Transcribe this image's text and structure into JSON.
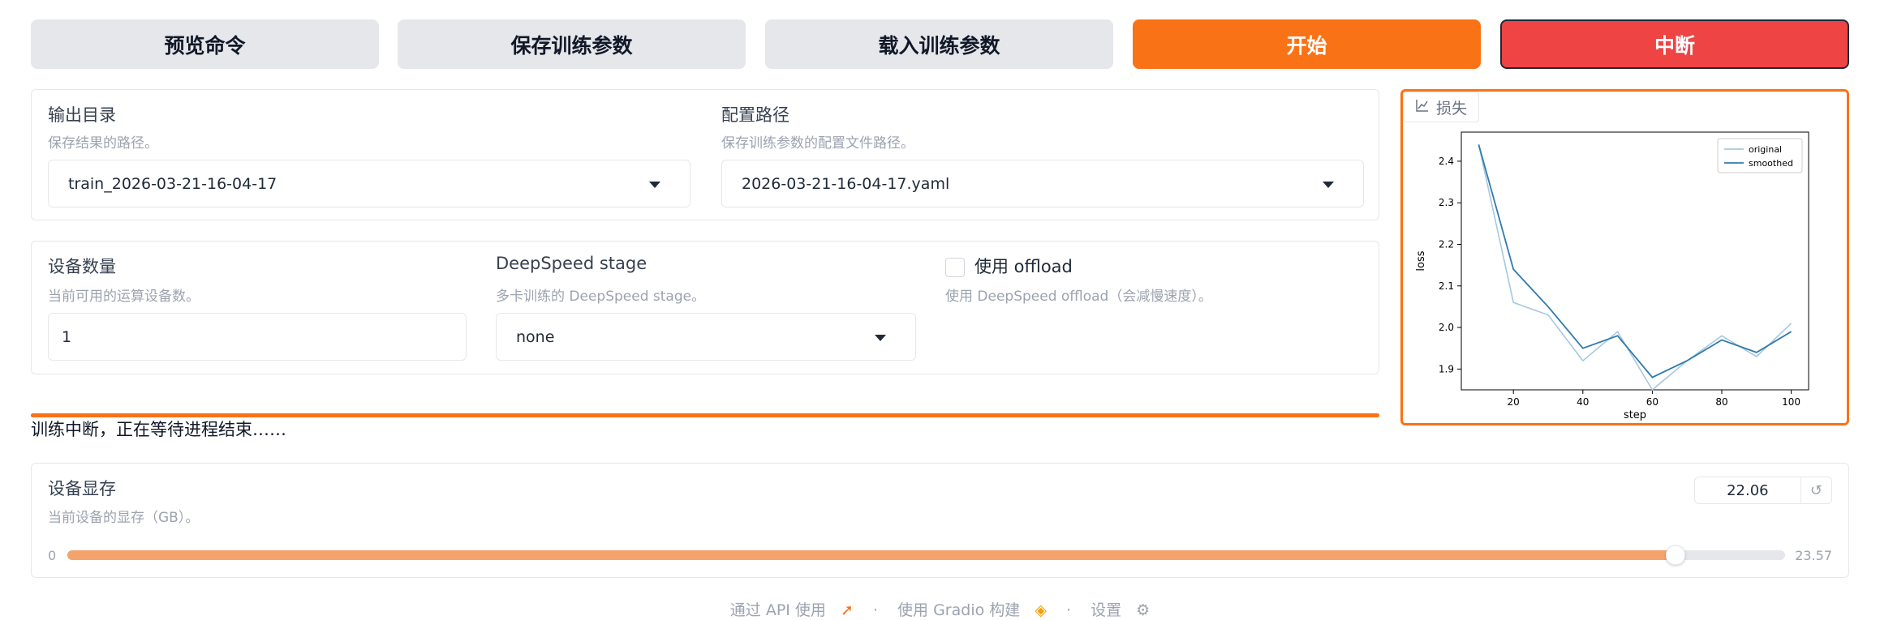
{
  "toolbar": {
    "preview_label": "预览命令",
    "save_label": "保存训练参数",
    "load_label": "载入训练参数",
    "start_label": "开始",
    "stop_label": "中断"
  },
  "output": {
    "output_dir_label": "输出目录",
    "output_dir_info": "保存结果的路径。",
    "output_dir_value": "train_2026-03-21-16-04-17",
    "config_path_label": "配置路径",
    "config_path_info": "保存训练参数的配置文件路径。",
    "config_path_value": "2026-03-21-16-04-17.yaml"
  },
  "device": {
    "count_label": "设备数量",
    "count_info": "当前可用的运算设备数。",
    "count_value": "1",
    "ds_stage_label": "DeepSpeed stage",
    "ds_stage_info": "多卡训练的 DeepSpeed stage。",
    "ds_stage_value": "none",
    "offload_label": "使用 offload",
    "offload_info": "使用 DeepSpeed offload（会减慢速度）。",
    "offload_checked": false
  },
  "status": {
    "message": "训练中断，正在等待进程结束……",
    "progress": 1.0
  },
  "memory": {
    "label": "设备显存",
    "info": "当前设备的显存（GB）。",
    "value": "22.06",
    "min": "0",
    "max": "23.57",
    "reset_icon": "↺"
  },
  "plot": {
    "tag_label": "损失",
    "tag_icon": "chart-icon"
  },
  "chart_data": {
    "type": "line",
    "xlabel": "step",
    "ylabel": "loss",
    "xlim": [
      5,
      105
    ],
    "ylim": [
      1.85,
      2.47
    ],
    "xticks": [
      20,
      40,
      60,
      80,
      100
    ],
    "yticks": [
      1.9,
      2.0,
      2.1,
      2.2,
      2.3,
      2.4
    ],
    "legend_position": "top-right",
    "series": [
      {
        "name": "original",
        "color": "#a6c8de",
        "x": [
          10,
          20,
          30,
          40,
          50,
          60,
          70,
          80,
          90,
          100
        ],
        "y": [
          2.44,
          2.06,
          2.03,
          1.92,
          1.99,
          1.85,
          1.92,
          1.98,
          1.93,
          2.01
        ]
      },
      {
        "name": "smoothed",
        "color": "#2f7bb0",
        "x": [
          10,
          20,
          30,
          40,
          50,
          60,
          70,
          80,
          90,
          100
        ],
        "y": [
          2.44,
          2.14,
          2.05,
          1.95,
          1.98,
          1.88,
          1.92,
          1.97,
          1.94,
          1.99
        ]
      }
    ]
  },
  "footer": {
    "api_label": "通过 API 使用",
    "gradio_label": "使用 Gradio 构建",
    "settings_label": "设置",
    "separator": "·"
  }
}
